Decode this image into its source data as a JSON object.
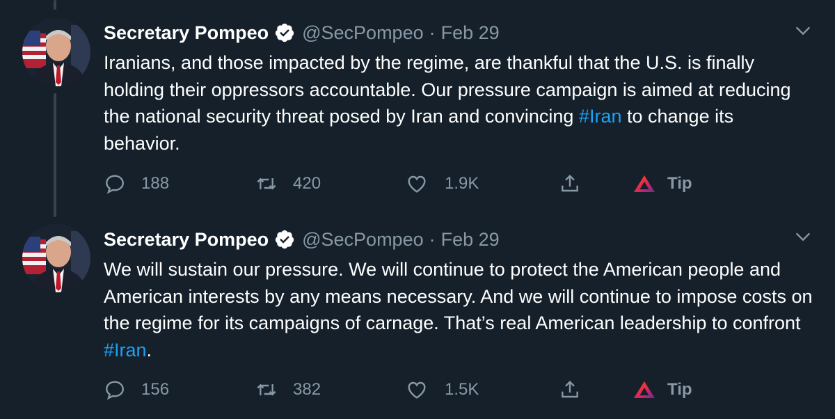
{
  "tweets": [
    {
      "author": "Secretary Pompeo",
      "handle": "@SecPompeo",
      "separator": "·",
      "date": "Feb 29",
      "text_before": "Iranians, and those impacted by the regime, are thankful that the U.S. is finally holding their oppressors accountable. Our pressure campaign is aimed at reducing the national security threat posed by Iran and convincing ",
      "hashtag": "#Iran",
      "text_after": " to change its behavior.",
      "replies": "188",
      "retweets": "420",
      "likes": "1.9K",
      "tip_label": "Tip"
    },
    {
      "author": "Secretary Pompeo",
      "handle": "@SecPompeo",
      "separator": "·",
      "date": "Feb 29",
      "text_before": "We will sustain our pressure. We will continue to protect the American people and American interests by any means necessary. And we will continue to impose costs on the regime for its campaigns of carnage. That’s real American leadership to confront ",
      "hashtag": "#Iran",
      "text_after": ".",
      "replies": "156",
      "retweets": "382",
      "likes": "1.5K",
      "tip_label": "Tip"
    }
  ],
  "colors": {
    "background": "#15202b",
    "text": "#ffffff",
    "secondary": "#8899a6",
    "link": "#1da1f2",
    "thread_line": "#38444d"
  },
  "icons": {
    "reply": "reply-icon",
    "retweet": "retweet-icon",
    "like": "heart-icon",
    "share": "share-icon",
    "tip": "brave-tip-icon",
    "verified": "verified-badge-icon",
    "caret": "chevron-down-icon"
  }
}
